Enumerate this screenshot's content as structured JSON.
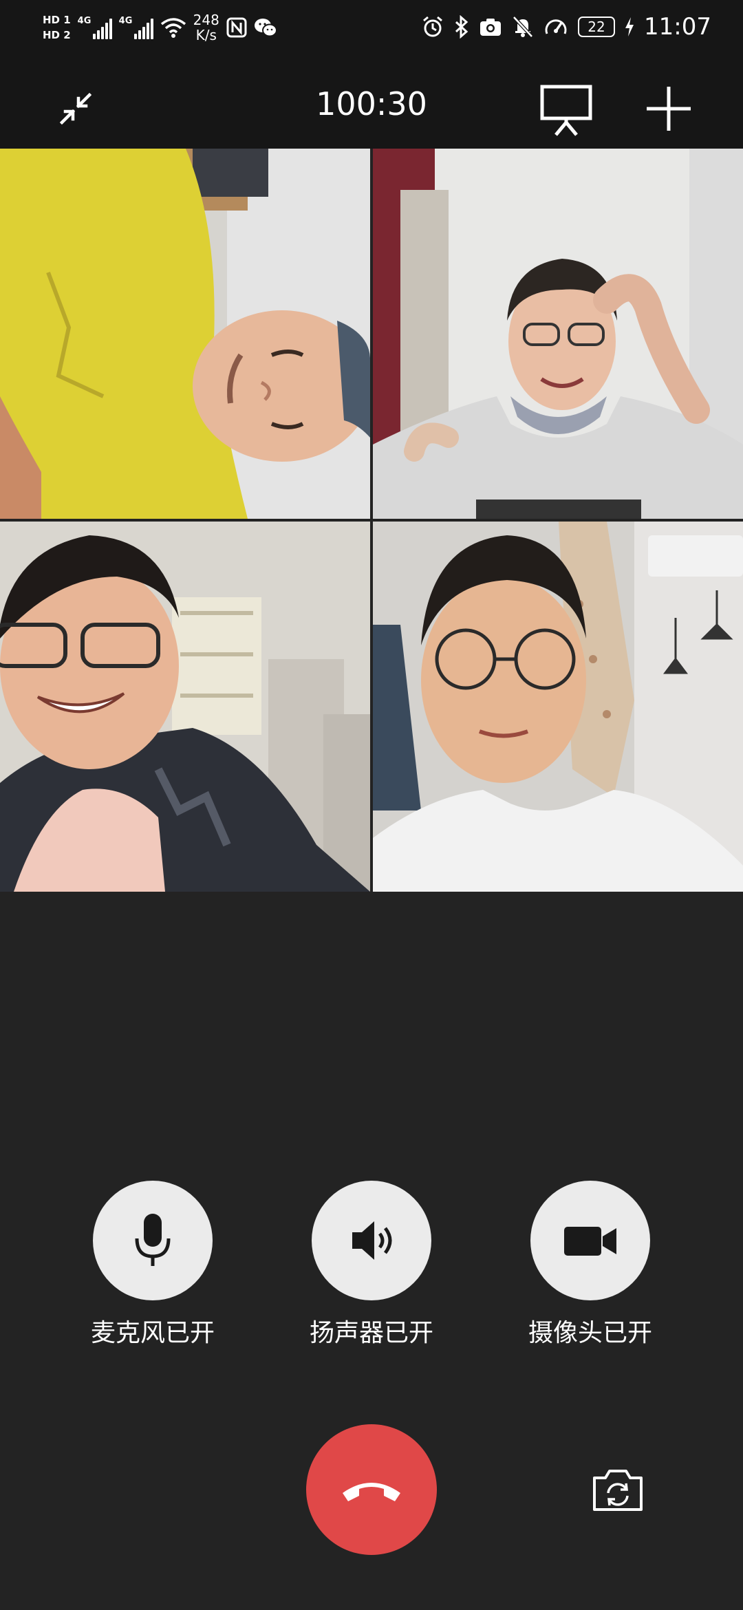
{
  "status_bar": {
    "sim1": "HD 1",
    "sim2": "HD 2",
    "network1": "4G",
    "network2": "4G",
    "speed_value": "248",
    "speed_unit": "K/s",
    "battery": "22",
    "time": "11:07"
  },
  "top_bar": {
    "timer": "100:30"
  },
  "participants": [
    {
      "id": "p1",
      "label": ""
    },
    {
      "id": "p2",
      "label": ""
    },
    {
      "id": "p3",
      "label": ""
    },
    {
      "id": "p4",
      "label": ""
    }
  ],
  "controls": {
    "mic_label": "麦克风已开",
    "speaker_label": "扬声器已开",
    "camera_label": "摄像头已开"
  },
  "colors": {
    "background": "#232323",
    "bar": "#161616",
    "control_circle": "#ebebeb",
    "hangup": "#e04848"
  }
}
